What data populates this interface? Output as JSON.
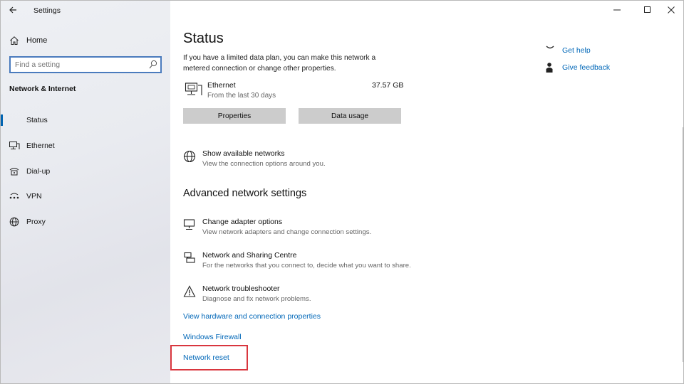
{
  "window": {
    "title": "Settings"
  },
  "sidebar": {
    "home_label": "Home",
    "search_placeholder": "Find a setting",
    "section_label": "Network & Internet",
    "items": [
      {
        "label": "Status",
        "icon": "status-icon",
        "active": true
      },
      {
        "label": "Ethernet",
        "icon": "ethernet-icon"
      },
      {
        "label": "Dial-up",
        "icon": "dialup-icon"
      },
      {
        "label": "VPN",
        "icon": "vpn-icon"
      },
      {
        "label": "Proxy",
        "icon": "globe-icon"
      }
    ]
  },
  "main": {
    "title": "Status",
    "description": "If you have a limited data plan, you can make this network a metered connection or change other properties.",
    "connection": {
      "name": "Ethernet",
      "sub": "From the last 30 days",
      "usage": "37.57 GB"
    },
    "buttons": {
      "properties": "Properties",
      "data_usage": "Data usage"
    },
    "show_networks": {
      "title": "Show available networks",
      "sub": "View the connection options around you."
    },
    "advanced_heading": "Advanced network settings",
    "advanced": [
      {
        "title": "Change adapter options",
        "sub": "View network adapters and change connection settings."
      },
      {
        "title": "Network and Sharing Centre",
        "sub": "For the networks that you connect to, decide what you want to share."
      },
      {
        "title": "Network troubleshooter",
        "sub": "Diagnose and fix network problems."
      }
    ],
    "links": {
      "hardware": "View hardware and connection properties",
      "firewall": "Windows Firewall",
      "reset": "Network reset"
    }
  },
  "related": {
    "get_help": "Get help",
    "give_feedback": "Give feedback"
  },
  "colors": {
    "accent": "#0067b8",
    "highlight": "#d9363e"
  }
}
